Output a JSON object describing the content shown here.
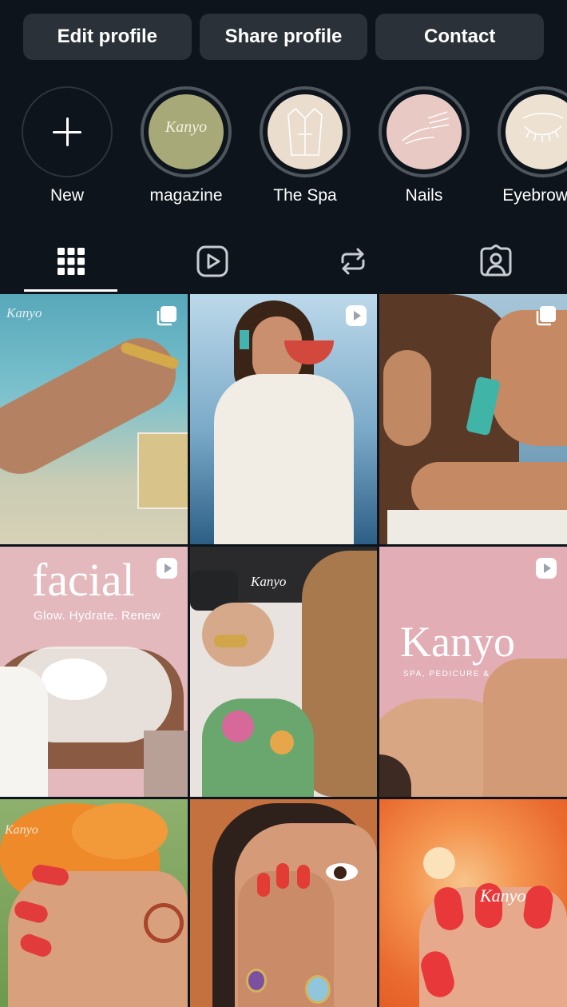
{
  "actions": {
    "edit": "Edit profile",
    "share": "Share profile",
    "contact": "Contact"
  },
  "highlights": [
    {
      "label": "New",
      "icon": "plus-icon"
    },
    {
      "label": "magazine",
      "cover_text": "Kanyo",
      "cover_color": "#a8a978"
    },
    {
      "label": "The Spa",
      "icon": "bathrobe-icon",
      "cover_color": "#eaddcd"
    },
    {
      "label": "Nails",
      "icon": "nail-brush-icon",
      "cover_color": "#e8c9c3"
    },
    {
      "label": "Eyebrow &",
      "icon": "eyelash-icon",
      "cover_color": "#ede1d2"
    }
  ],
  "tabs": [
    {
      "name": "posts",
      "icon": "grid-icon",
      "active": true
    },
    {
      "name": "reels",
      "icon": "reels-icon"
    },
    {
      "name": "reposts",
      "icon": "repost-icon"
    },
    {
      "name": "tagged",
      "icon": "tagged-person-icon"
    }
  ],
  "posts": [
    {
      "type": "carousel",
      "overlay": "Kanyo"
    },
    {
      "type": "reel"
    },
    {
      "type": "carousel"
    },
    {
      "type": "reel",
      "title": "facial",
      "subtitle": "Glow. Hydrate. Renew"
    },
    {
      "type": "photo",
      "overlay": "Kanyo"
    },
    {
      "type": "reel",
      "title": "Kanyo",
      "subtitle": "SPA, PEDICURE &"
    },
    {
      "type": "photo",
      "overlay": "Kanyo"
    },
    {
      "type": "photo"
    },
    {
      "type": "photo",
      "overlay": "Kanyo"
    }
  ],
  "colors": {
    "background": "#0d141b",
    "button": "#2a3138",
    "ring": "#4f555c"
  }
}
